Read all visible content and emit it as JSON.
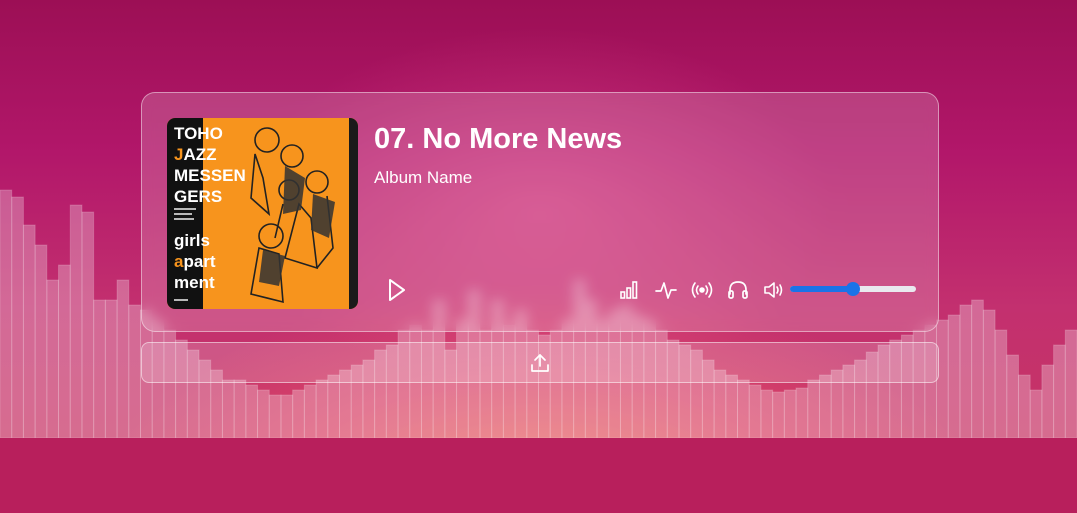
{
  "player": {
    "track_title": "07. No More News",
    "album_name": "Album Name",
    "volume": 0.5,
    "cover": {
      "title_lines": [
        "TOHO",
        "JAZZ",
        "MESSEN",
        "GERS"
      ],
      "subtitle_lines": [
        "girls",
        "apart",
        "ment"
      ]
    }
  },
  "colors": {
    "accent": "#1a73e8",
    "cover_orange": "#f7941d"
  },
  "icons": {
    "play": "play-icon",
    "bars": "signal-bars-icon",
    "waveform": "waveform-icon",
    "broadcast": "broadcast-icon",
    "headphones": "headphones-icon",
    "volume": "volume-icon",
    "upload": "upload-icon"
  }
}
